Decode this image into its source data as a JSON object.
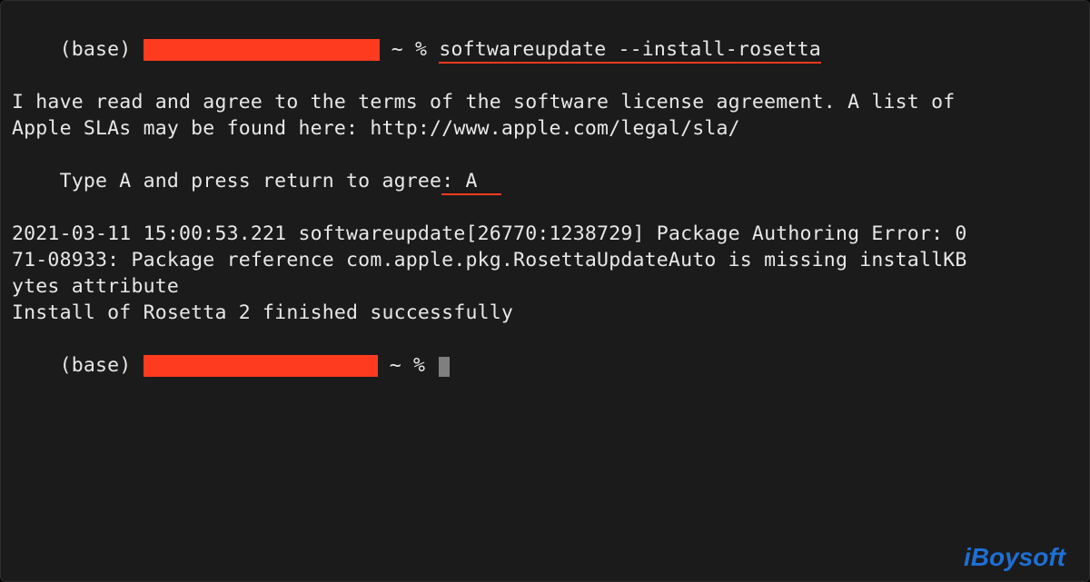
{
  "terminal": {
    "prompt_env": "(base)",
    "prompt_tail": " ~ % ",
    "command": "softwareupdate --install-rosetta",
    "output": {
      "line1": "I have read and agree to the terms of the software license agreement. A list of",
      "line2": "Apple SLAs may be found here: http://www.apple.com/legal/sla/",
      "agree_prompt": "Type A and press return to agree",
      "agree_colon": ": ",
      "agree_input": "A",
      "line4": "2021-03-11 15:00:53.221 softwareupdate[26770:1238729] Package Authoring Error: 0",
      "line5": "71-08933: Package reference com.apple.pkg.RosettaUpdateAuto is missing installKB",
      "line6": "ytes attribute",
      "line7": "Install of Rosetta 2 finished successfully"
    }
  },
  "watermark": "iBoysoft"
}
